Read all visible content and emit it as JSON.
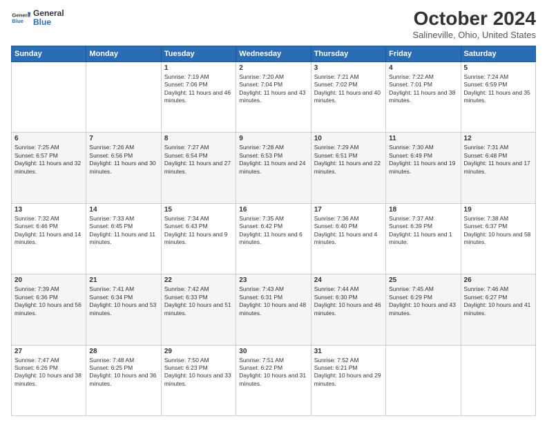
{
  "header": {
    "logo_general": "General",
    "logo_blue": "Blue",
    "title": "October 2024",
    "location": "Salineville, Ohio, United States"
  },
  "columns": [
    "Sunday",
    "Monday",
    "Tuesday",
    "Wednesday",
    "Thursday",
    "Friday",
    "Saturday"
  ],
  "weeks": [
    [
      {
        "day": "",
        "sunrise": "",
        "sunset": "",
        "daylight": ""
      },
      {
        "day": "",
        "sunrise": "",
        "sunset": "",
        "daylight": ""
      },
      {
        "day": "1",
        "sunrise": "Sunrise: 7:19 AM",
        "sunset": "Sunset: 7:06 PM",
        "daylight": "Daylight: 11 hours and 46 minutes."
      },
      {
        "day": "2",
        "sunrise": "Sunrise: 7:20 AM",
        "sunset": "Sunset: 7:04 PM",
        "daylight": "Daylight: 11 hours and 43 minutes."
      },
      {
        "day": "3",
        "sunrise": "Sunrise: 7:21 AM",
        "sunset": "Sunset: 7:02 PM",
        "daylight": "Daylight: 11 hours and 40 minutes."
      },
      {
        "day": "4",
        "sunrise": "Sunrise: 7:22 AM",
        "sunset": "Sunset: 7:01 PM",
        "daylight": "Daylight: 11 hours and 38 minutes."
      },
      {
        "day": "5",
        "sunrise": "Sunrise: 7:24 AM",
        "sunset": "Sunset: 6:59 PM",
        "daylight": "Daylight: 11 hours and 35 minutes."
      }
    ],
    [
      {
        "day": "6",
        "sunrise": "Sunrise: 7:25 AM",
        "sunset": "Sunset: 6:57 PM",
        "daylight": "Daylight: 11 hours and 32 minutes."
      },
      {
        "day": "7",
        "sunrise": "Sunrise: 7:26 AM",
        "sunset": "Sunset: 6:56 PM",
        "daylight": "Daylight: 11 hours and 30 minutes."
      },
      {
        "day": "8",
        "sunrise": "Sunrise: 7:27 AM",
        "sunset": "Sunset: 6:54 PM",
        "daylight": "Daylight: 11 hours and 27 minutes."
      },
      {
        "day": "9",
        "sunrise": "Sunrise: 7:28 AM",
        "sunset": "Sunset: 6:53 PM",
        "daylight": "Daylight: 11 hours and 24 minutes."
      },
      {
        "day": "10",
        "sunrise": "Sunrise: 7:29 AM",
        "sunset": "Sunset: 6:51 PM",
        "daylight": "Daylight: 11 hours and 22 minutes."
      },
      {
        "day": "11",
        "sunrise": "Sunrise: 7:30 AM",
        "sunset": "Sunset: 6:49 PM",
        "daylight": "Daylight: 11 hours and 19 minutes."
      },
      {
        "day": "12",
        "sunrise": "Sunrise: 7:31 AM",
        "sunset": "Sunset: 6:48 PM",
        "daylight": "Daylight: 11 hours and 17 minutes."
      }
    ],
    [
      {
        "day": "13",
        "sunrise": "Sunrise: 7:32 AM",
        "sunset": "Sunset: 6:46 PM",
        "daylight": "Daylight: 11 hours and 14 minutes."
      },
      {
        "day": "14",
        "sunrise": "Sunrise: 7:33 AM",
        "sunset": "Sunset: 6:45 PM",
        "daylight": "Daylight: 11 hours and 11 minutes."
      },
      {
        "day": "15",
        "sunrise": "Sunrise: 7:34 AM",
        "sunset": "Sunset: 6:43 PM",
        "daylight": "Daylight: 11 hours and 9 minutes."
      },
      {
        "day": "16",
        "sunrise": "Sunrise: 7:35 AM",
        "sunset": "Sunset: 6:42 PM",
        "daylight": "Daylight: 11 hours and 6 minutes."
      },
      {
        "day": "17",
        "sunrise": "Sunrise: 7:36 AM",
        "sunset": "Sunset: 6:40 PM",
        "daylight": "Daylight: 11 hours and 4 minutes."
      },
      {
        "day": "18",
        "sunrise": "Sunrise: 7:37 AM",
        "sunset": "Sunset: 6:39 PM",
        "daylight": "Daylight: 11 hours and 1 minute."
      },
      {
        "day": "19",
        "sunrise": "Sunrise: 7:38 AM",
        "sunset": "Sunset: 6:37 PM",
        "daylight": "Daylight: 10 hours and 58 minutes."
      }
    ],
    [
      {
        "day": "20",
        "sunrise": "Sunrise: 7:39 AM",
        "sunset": "Sunset: 6:36 PM",
        "daylight": "Daylight: 10 hours and 56 minutes."
      },
      {
        "day": "21",
        "sunrise": "Sunrise: 7:41 AM",
        "sunset": "Sunset: 6:34 PM",
        "daylight": "Daylight: 10 hours and 53 minutes."
      },
      {
        "day": "22",
        "sunrise": "Sunrise: 7:42 AM",
        "sunset": "Sunset: 6:33 PM",
        "daylight": "Daylight: 10 hours and 51 minutes."
      },
      {
        "day": "23",
        "sunrise": "Sunrise: 7:43 AM",
        "sunset": "Sunset: 6:31 PM",
        "daylight": "Daylight: 10 hours and 48 minutes."
      },
      {
        "day": "24",
        "sunrise": "Sunrise: 7:44 AM",
        "sunset": "Sunset: 6:30 PM",
        "daylight": "Daylight: 10 hours and 46 minutes."
      },
      {
        "day": "25",
        "sunrise": "Sunrise: 7:45 AM",
        "sunset": "Sunset: 6:29 PM",
        "daylight": "Daylight: 10 hours and 43 minutes."
      },
      {
        "day": "26",
        "sunrise": "Sunrise: 7:46 AM",
        "sunset": "Sunset: 6:27 PM",
        "daylight": "Daylight: 10 hours and 41 minutes."
      }
    ],
    [
      {
        "day": "27",
        "sunrise": "Sunrise: 7:47 AM",
        "sunset": "Sunset: 6:26 PM",
        "daylight": "Daylight: 10 hours and 38 minutes."
      },
      {
        "day": "28",
        "sunrise": "Sunrise: 7:48 AM",
        "sunset": "Sunset: 6:25 PM",
        "daylight": "Daylight: 10 hours and 36 minutes."
      },
      {
        "day": "29",
        "sunrise": "Sunrise: 7:50 AM",
        "sunset": "Sunset: 6:23 PM",
        "daylight": "Daylight: 10 hours and 33 minutes."
      },
      {
        "day": "30",
        "sunrise": "Sunrise: 7:51 AM",
        "sunset": "Sunset: 6:22 PM",
        "daylight": "Daylight: 10 hours and 31 minutes."
      },
      {
        "day": "31",
        "sunrise": "Sunrise: 7:52 AM",
        "sunset": "Sunset: 6:21 PM",
        "daylight": "Daylight: 10 hours and 29 minutes."
      },
      {
        "day": "",
        "sunrise": "",
        "sunset": "",
        "daylight": ""
      },
      {
        "day": "",
        "sunrise": "",
        "sunset": "",
        "daylight": ""
      }
    ]
  ]
}
